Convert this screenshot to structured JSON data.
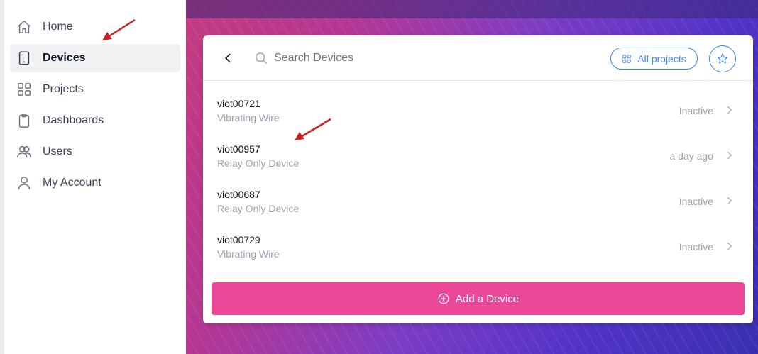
{
  "sidebar": {
    "items": [
      {
        "label": "Home",
        "icon": "home-icon",
        "active": false
      },
      {
        "label": "Devices",
        "icon": "tablet-icon",
        "active": true
      },
      {
        "label": "Projects",
        "icon": "grid-icon",
        "active": false
      },
      {
        "label": "Dashboards",
        "icon": "clipboard-icon",
        "active": false
      },
      {
        "label": "Users",
        "icon": "users-icon",
        "active": false
      },
      {
        "label": "My Account",
        "icon": "user-icon",
        "active": false
      }
    ]
  },
  "header": {
    "search_placeholder": "Search Devices",
    "projects_label": "All projects"
  },
  "devices": [
    {
      "name": "viot00721",
      "type": "Vibrating Wire",
      "status": "Inactive"
    },
    {
      "name": "viot00957",
      "type": "Relay Only Device",
      "status": "a day ago"
    },
    {
      "name": "viot00687",
      "type": "Relay Only Device",
      "status": "Inactive"
    },
    {
      "name": "viot00729",
      "type": "Vibrating Wire",
      "status": "Inactive"
    }
  ],
  "add_button_label": "Add a Device",
  "colors": {
    "accent": "#3b82f6",
    "add_button": "#ec4899",
    "annotation_arrow": "#cc1f1f"
  }
}
